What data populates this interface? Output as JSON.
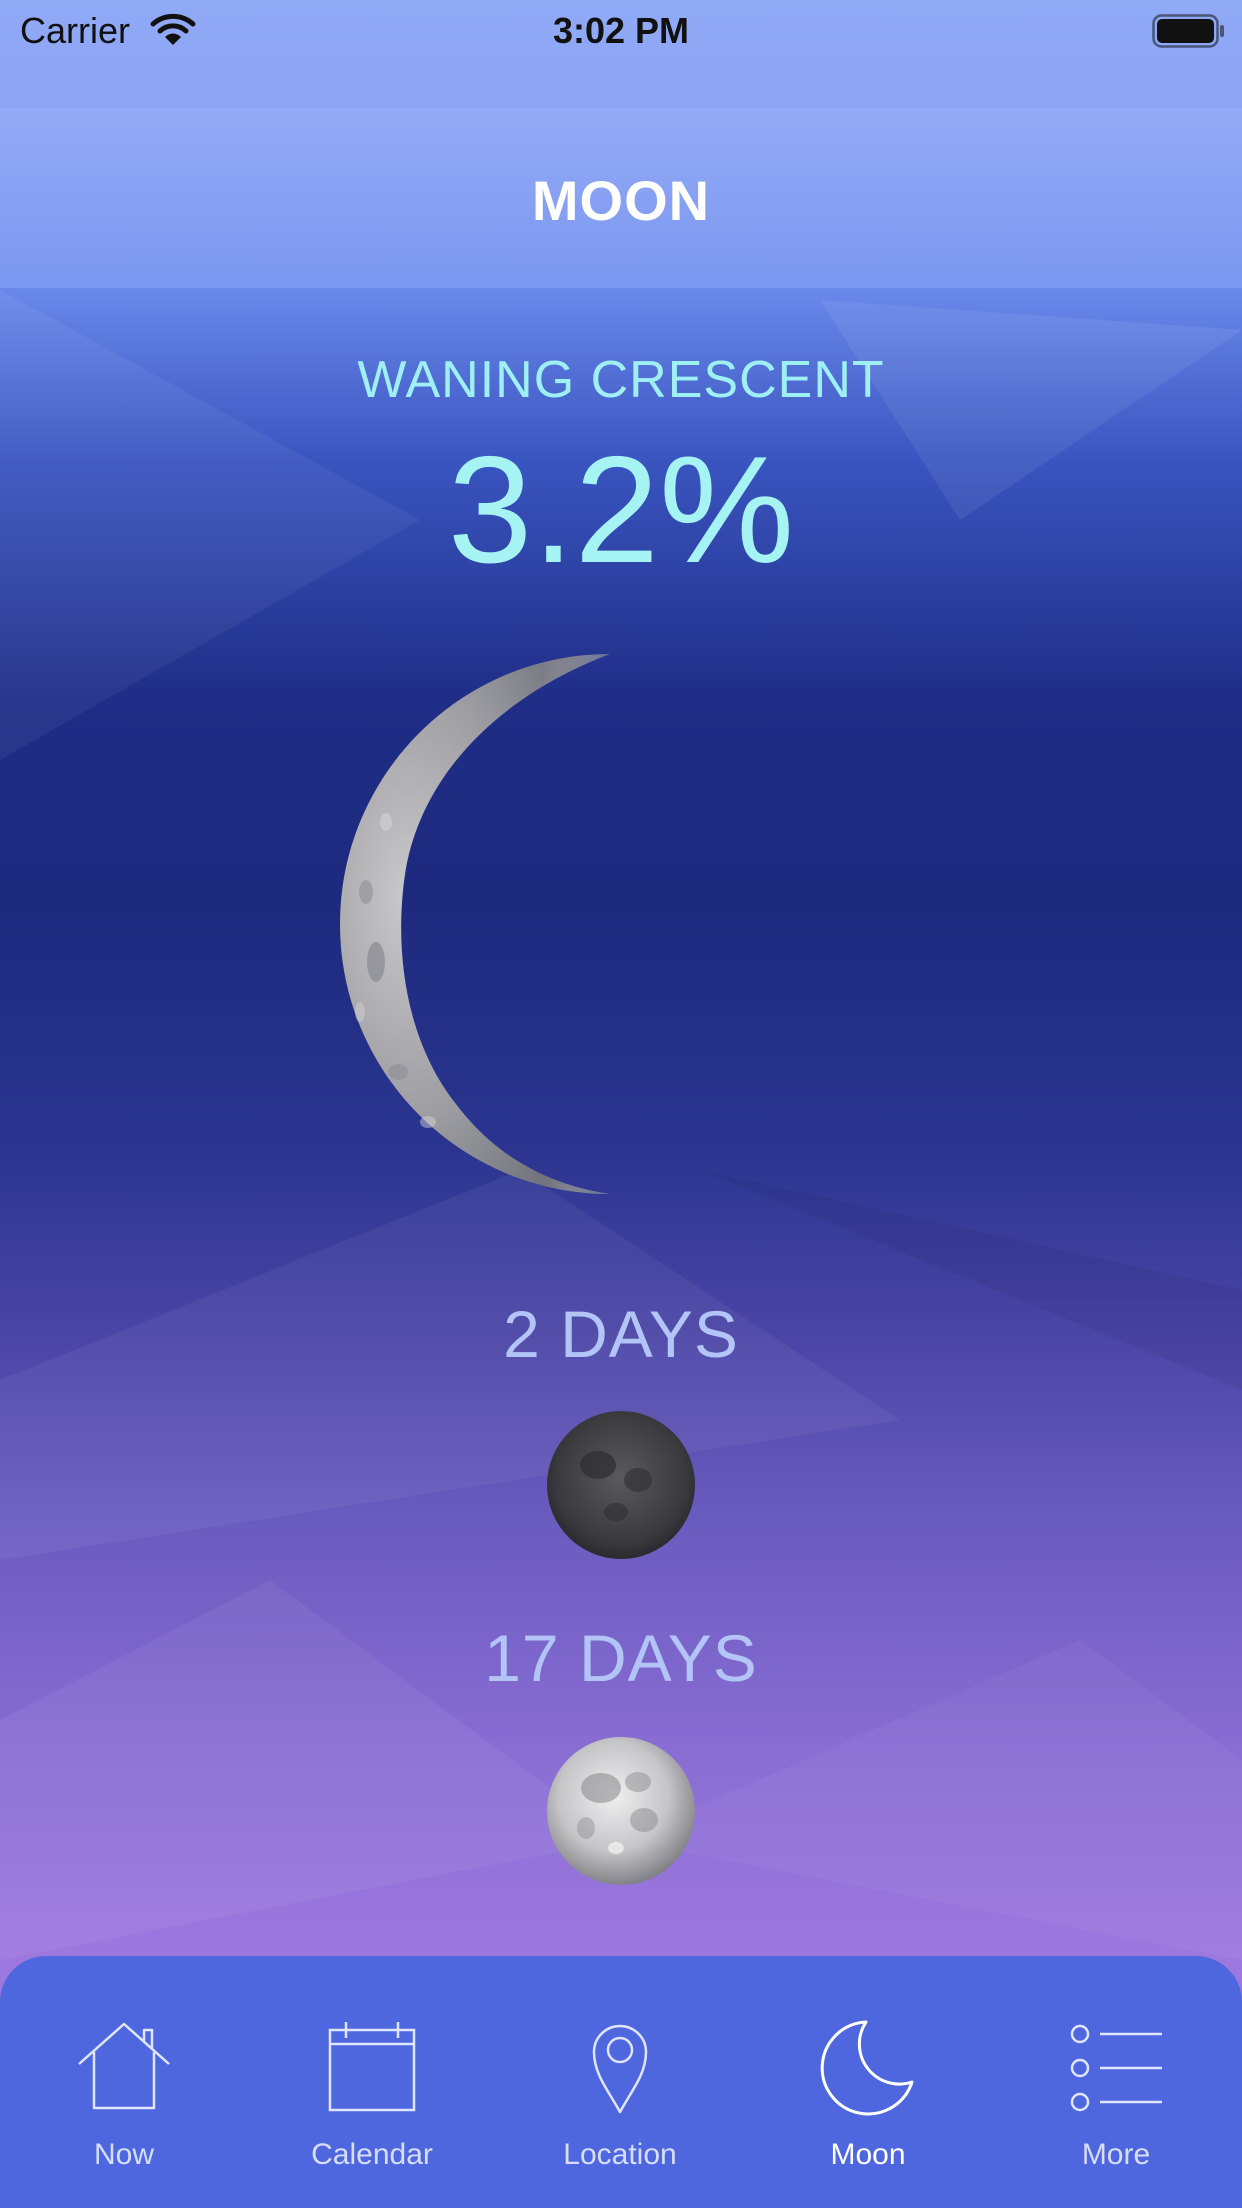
{
  "status_bar": {
    "carrier": "Carrier",
    "time": "3:02 PM",
    "wifi_icon": "wifi-icon",
    "battery_icon": "battery-full-icon"
  },
  "nav": {
    "title": "MOON"
  },
  "moon": {
    "phase_name": "WANING CRESCENT",
    "illumination": "3.2%",
    "illumination_value": 3.2,
    "image": "waning-crescent-moon-image"
  },
  "upcoming": [
    {
      "label": "2 DAYS",
      "image": "new-moon-image"
    },
    {
      "label": "17 DAYS",
      "image": "full-moon-image"
    }
  ],
  "tabs": [
    {
      "label": "Now",
      "icon": "house-icon",
      "active": false
    },
    {
      "label": "Calendar",
      "icon": "calendar-icon",
      "active": false
    },
    {
      "label": "Location",
      "icon": "location-pin-icon",
      "active": false
    },
    {
      "label": "Moon",
      "icon": "moon-icon",
      "active": true
    },
    {
      "label": "More",
      "icon": "list-icon",
      "active": false
    }
  ],
  "colors": {
    "tabbar": "#4f67de",
    "phase_text": "#9ff0f4",
    "days_text": "#b3c5f6"
  }
}
